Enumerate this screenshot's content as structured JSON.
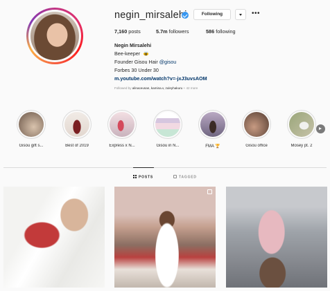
{
  "profile": {
    "username": "negin_mirsalehi",
    "follow_button": "Following",
    "stats": {
      "posts_count": "7,160",
      "posts_label": "posts",
      "followers_count": "5.7m",
      "followers_label": "followers",
      "following_count": "586",
      "following_label": "following"
    },
    "bio": {
      "name": "Negin Mirsalehi",
      "line1": "Bee-keeper",
      "line2_prefix": "Founder Gisou Hair",
      "line2_mention": "@gisou",
      "line3": "Forbes 30 Under 30",
      "link": "m.youtube.com/watch?v=-jxJ3uvsAOM"
    },
    "followed_by": {
      "prefix": "Followed by",
      "names": "alinaceusan, kamina.v, zuleyhakuru",
      "suffix": "+ 42 more"
    }
  },
  "highlights": [
    {
      "label": "Gisou gift s..."
    },
    {
      "label": "Best of 2019"
    },
    {
      "label": "Express x N..."
    },
    {
      "label": "Gisou in N..."
    },
    {
      "label": "FMA 🏆"
    },
    {
      "label": "Gisou office"
    },
    {
      "label": "Mosey pt. 2"
    }
  ],
  "tabs": {
    "posts": "POSTS",
    "tagged": "TAGGED"
  },
  "colors": {
    "verified": "#3897f0",
    "link": "#003569",
    "muted": "#8e8e8e"
  }
}
